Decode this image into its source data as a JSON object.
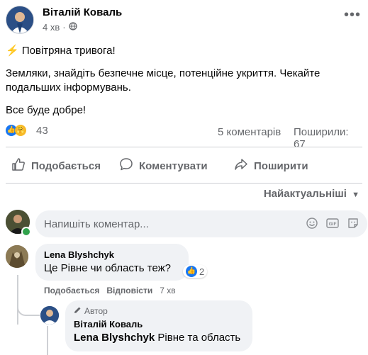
{
  "post": {
    "author": "Віталій Коваль",
    "time": "4 хв",
    "privacy_icon": "globe-icon",
    "lines": [
      "Повітряна тривога!",
      "Земляки, знайдіть безпечне місце, потенційне укриття. Чекайте",
      "подальших інформувань.",
      "Все буде добре!"
    ],
    "reactions_count": "43",
    "comments_count": "5 коментарів",
    "shares_count": "Поширили: 67"
  },
  "actions": {
    "like": "Подобається",
    "comment": "Коментувати",
    "share": "Поширити"
  },
  "sort_label": "Найактуальніші",
  "composer": {
    "placeholder": "Напишіть коментар..."
  },
  "comments": [
    {
      "author": "Lena Blyshchyk",
      "text": "Це Рівне чи область теж?",
      "reaction_count": "2",
      "like_label": "Подобається",
      "reply_label": "Відповісти",
      "time": "7 хв"
    }
  ],
  "reply": {
    "badge": "Автор",
    "author": "Віталій Коваль",
    "mention": "Lena Blyshchyk",
    "text": "Рівне та область"
  },
  "colors": {
    "accent": "#1877f2",
    "muted": "#65676b",
    "bubble": "#f0f2f5",
    "online": "#31a24c"
  }
}
